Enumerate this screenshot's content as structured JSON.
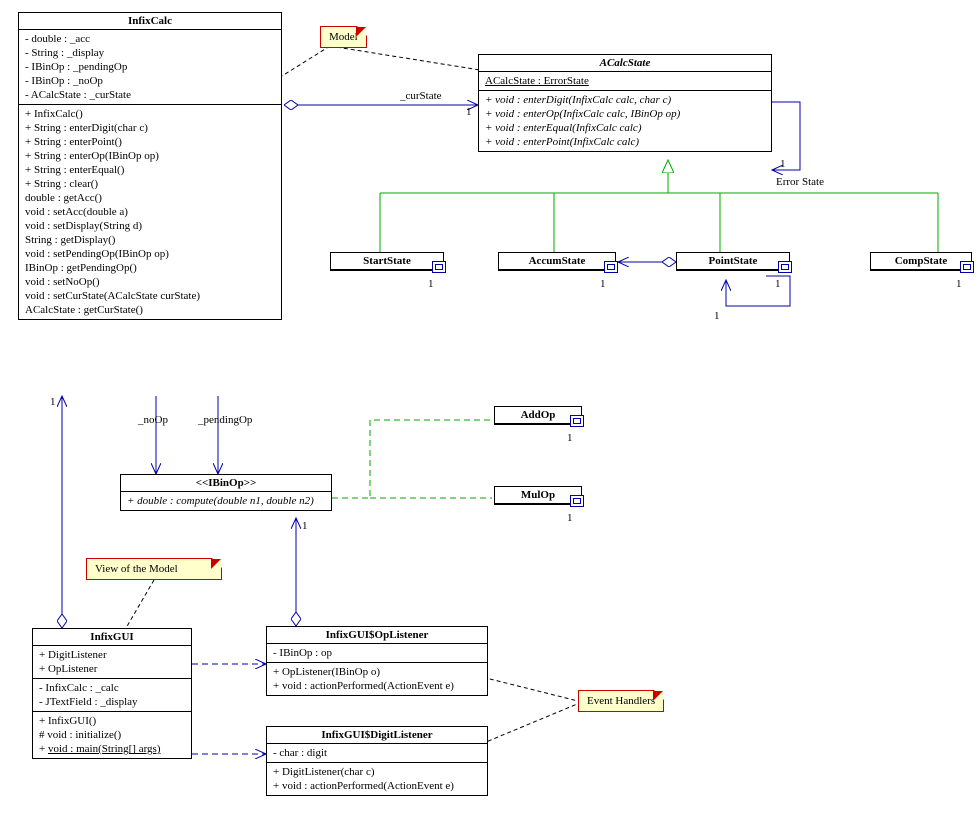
{
  "notes": {
    "model": "Model",
    "view": "View of the Model",
    "handlers": "Event Handlers"
  },
  "classes": {
    "infixcalc": {
      "name": "InfixCalc",
      "attrs": [
        {
          "vis": "-",
          "text": "double : _acc"
        },
        {
          "vis": "-",
          "text": "String : _display"
        },
        {
          "vis": "-",
          "text": "IBinOp : _pendingOp"
        },
        {
          "vis": "-",
          "text": "IBinOp : _noOp"
        },
        {
          "vis": "-",
          "text": "ACalcState : _curState"
        }
      ],
      "ops": [
        {
          "vis": "+",
          "text": "InfixCalc()"
        },
        {
          "vis": "+",
          "text": "String : enterDigit(char c)"
        },
        {
          "vis": "+",
          "text": "String : enterPoint()"
        },
        {
          "vis": "+",
          "text": "String : enterOp(IBinOp op)"
        },
        {
          "vis": "+",
          "text": "String : enterEqual()"
        },
        {
          "vis": "+",
          "text": "String : clear()"
        },
        {
          "vis": "",
          "text": "double : getAcc()"
        },
        {
          "vis": "",
          "text": "void : setAcc(double a)"
        },
        {
          "vis": "",
          "text": "void : setDisplay(String d)"
        },
        {
          "vis": "",
          "text": "String : getDisplay()"
        },
        {
          "vis": "",
          "text": "void : setPendingOp(IBinOp op)"
        },
        {
          "vis": "",
          "text": "IBinOp : getPendingOp()"
        },
        {
          "vis": "",
          "text": "void : setNoOp()"
        },
        {
          "vis": "",
          "text": "void : setCurState(ACalcState curState)"
        },
        {
          "vis": "",
          "text": "ACalcState : getCurState()"
        }
      ]
    },
    "acalcstate": {
      "name": "ACalcState",
      "attrs": [
        {
          "vis": "",
          "text": "ACalcState : ErrorState",
          "underline": true
        }
      ],
      "ops": [
        {
          "vis": "+",
          "text": "void : enterDigit(InfixCalc calc, char c)",
          "italic": true
        },
        {
          "vis": "+",
          "text": "void : enterOp(InfixCalc calc, IBinOp op)",
          "italic": true
        },
        {
          "vis": "+",
          "text": "void : enterEqual(InfixCalc calc)",
          "italic": true
        },
        {
          "vis": "+",
          "text": "void : enterPoint(InfixCalc calc)",
          "italic": true
        }
      ]
    },
    "startstate": {
      "name": "StartState"
    },
    "accumstate": {
      "name": "AccumState"
    },
    "pointstate": {
      "name": "PointState"
    },
    "compstate": {
      "name": "CompState"
    },
    "addop": {
      "name": "AddOp"
    },
    "mulop": {
      "name": "MulOp"
    },
    "ibinop": {
      "stereotype": "<<IBinOp>>",
      "ops": [
        {
          "vis": "+",
          "text": "double : compute(double n1, double n2)",
          "italic": true
        }
      ]
    },
    "infixgui": {
      "name": "InfixGUI",
      "inner": [
        {
          "vis": "+",
          "text": "DigitListener"
        },
        {
          "vis": "+",
          "text": "OpListener"
        }
      ],
      "attrs": [
        {
          "vis": "-",
          "text": "InfixCalc : _calc"
        },
        {
          "vis": "-",
          "text": "JTextField : _display"
        }
      ],
      "ops": [
        {
          "vis": "+",
          "text": "InfixGUI()"
        },
        {
          "vis": "#",
          "text": "void : initialize()"
        },
        {
          "vis": "+",
          "text": "void : main(String[] args)",
          "underline": true
        }
      ]
    },
    "oplistener": {
      "name": "InfixGUI$OpListener",
      "attrs": [
        {
          "vis": "-",
          "text": "IBinOp : op"
        }
      ],
      "ops": [
        {
          "vis": "+",
          "text": "OpListener(IBinOp o)"
        },
        {
          "vis": "+",
          "text": "void : actionPerformed(ActionEvent e)"
        }
      ]
    },
    "digitlistener": {
      "name": "InfixGUI$DigitListener",
      "attrs": [
        {
          "vis": "-",
          "text": "char : digit"
        }
      ],
      "ops": [
        {
          "vis": "+",
          "text": "DigitListener(char c)"
        },
        {
          "vis": "+",
          "text": "void : actionPerformed(ActionEvent e)"
        }
      ]
    }
  },
  "labels": {
    "curstate": "_curState",
    "noop": "_noOp",
    "pendingop": "_pendingOp",
    "errorstate": "Error State"
  },
  "mult": {
    "one": "1"
  }
}
